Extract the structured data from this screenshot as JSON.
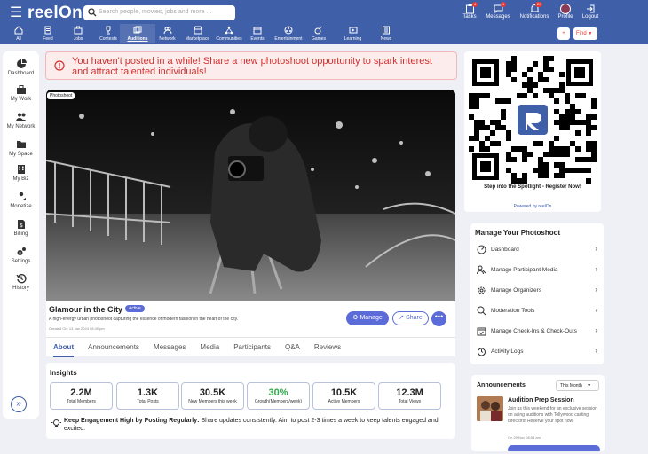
{
  "header": {
    "app_name": "reelOn",
    "search_placeholder": "Search people, movies, jobs and more ...",
    "nav": [
      {
        "label": "All",
        "icon": "home-icon"
      },
      {
        "label": "Feed",
        "icon": "feed-icon"
      },
      {
        "label": "Jobs",
        "icon": "briefcase-icon"
      },
      {
        "label": "Contests",
        "icon": "trophy-icon"
      },
      {
        "label": "Auditions",
        "icon": "auditions-icon",
        "active": true
      },
      {
        "label": "Network",
        "icon": "network-icon"
      },
      {
        "label": "Marketplace",
        "icon": "store-icon"
      },
      {
        "label": "Communities",
        "icon": "communities-icon"
      },
      {
        "label": "Events",
        "icon": "calendar-icon"
      },
      {
        "label": "Entertainment",
        "icon": "film-reel-icon"
      },
      {
        "label": "Games",
        "icon": "games-icon"
      },
      {
        "label": "Learning",
        "icon": "learning-icon"
      },
      {
        "label": "News",
        "icon": "news-icon"
      }
    ],
    "right": {
      "tasks_label": "Tasks",
      "tasks_count": "4",
      "messages_label": "Messages",
      "messages_count": "1",
      "notifications_label": "Notifications",
      "notifications_count": "20",
      "profile_label": "Profile",
      "logout_label": "Logout"
    },
    "add_label": "+",
    "find_label": "Find"
  },
  "sidebar": {
    "items": [
      {
        "label": "Dashboard",
        "icon": "pie-chart-icon"
      },
      {
        "label": "My Work",
        "icon": "briefcase-icon"
      },
      {
        "label": "My Network",
        "icon": "people-icon"
      },
      {
        "label": "My Space",
        "icon": "folder-icon"
      },
      {
        "label": "My Biz",
        "icon": "building-icon"
      },
      {
        "label": "Monetize",
        "icon": "hand-money-icon"
      },
      {
        "label": "Billing",
        "icon": "invoice-icon"
      },
      {
        "label": "Settings",
        "icon": "gears-icon"
      },
      {
        "label": "History",
        "icon": "history-icon"
      }
    ],
    "collapse_label": "»"
  },
  "alert": {
    "text": "You haven't posted in a while! Share a new photoshoot opportunity to spark interest and attract talented individuals!"
  },
  "post": {
    "tag": "Photoshoot",
    "title": "Glamour in the City",
    "status": "Active",
    "description": "A high-energy urban photoshoot capturing the essence of modern fashion in the heart of the city.",
    "created": "Created On: 13 Jan 2024 08:40 pm",
    "manage_label": "Manage",
    "share_label": "Share",
    "more_label": "•••"
  },
  "tabs": [
    "About",
    "Announcements",
    "Messages",
    "Media",
    "Participants",
    "Q&A",
    "Reviews"
  ],
  "insights": {
    "title": "Insights",
    "cards": [
      {
        "value": "2.2M",
        "label": "Total Members"
      },
      {
        "value": "1.3K",
        "label": "Total Posts"
      },
      {
        "value": "30.5K",
        "label": "New Members this week"
      },
      {
        "value": "30%",
        "label": "Growth(Members/week)",
        "color": "#2eaa4a"
      },
      {
        "value": "10.5K",
        "label": "Active Members"
      },
      {
        "value": "12.3M",
        "label": "Total Views"
      }
    ],
    "tip_bold": "Keep Engagement High by Posting Regularly:",
    "tip_text": " Share updates consistently. Aim to post 2-3 times a week to keep talents engaged and excited."
  },
  "qr": {
    "caption": "Step into the Spotlight - Register Now!",
    "by": "Powered by reelOn"
  },
  "manage": {
    "title": "Manage Your Photoshoot",
    "items": [
      {
        "label": "Dashboard",
        "icon": "dashboard-gauge-icon"
      },
      {
        "label": "Manage Participant Media",
        "icon": "participant-media-icon"
      },
      {
        "label": "Manage Organizers",
        "icon": "organizers-gear-icon"
      },
      {
        "label": "Moderation Tools",
        "icon": "moderation-icon"
      },
      {
        "label": "Manage Check-Ins & Check-Outs",
        "icon": "checkin-calendar-icon"
      },
      {
        "label": "Activity Logs",
        "icon": "activity-log-icon"
      }
    ]
  },
  "announcements": {
    "title": "Announcements",
    "filter": "This Month",
    "item": {
      "title": "Audition Prep Session",
      "body": "Join us this weekend for an exclusive session on acing auditions with Tollywood casting directors! Reserve your spot now.",
      "date": "On 29 Nov 08:58 am"
    }
  },
  "colors": {
    "primary": "#3f5fa9",
    "accent": "#5b6bd8",
    "alert": "#d32f2f",
    "growth": "#2eaa4a"
  }
}
